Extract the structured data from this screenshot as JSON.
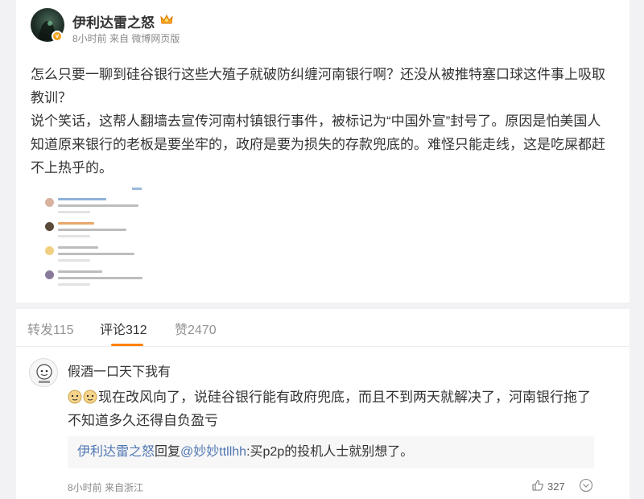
{
  "post": {
    "author": "伊利达雷之怒",
    "meta": "8小时前 来自 微博网页版",
    "paragraphs": [
      "怎么只要一聊到硅谷银行这些大殖子就破防纠缠河南银行啊？还没从被推特塞口球这件事上吸取教训？",
      "说个笑话，这帮人翻墙去宣传河南村镇银行事件，被标记为“中国外宣”封号了。原因是怕美国人知道原来银行的老板是要坐牢的，政府是要为损失的存款兜底的。难怪只能走线，这是吃屎都赶不上热乎的。"
    ]
  },
  "tabs": {
    "repost": "转发115",
    "comment": "评论312",
    "like": "赞2470"
  },
  "comment": {
    "author": "假酒一口天下我有",
    "text": "现在改风向了，说硅谷银行能有政府兜底，而且不到两天就解决了，河南银行拖了不知道多久还得自负盈亏",
    "reply": {
      "author": "伊利达雷之怒",
      "verb": "回复",
      "mention": "@妙妙ttllhh",
      "text": ":买p2p的投机人士就别想了。"
    },
    "meta": "8小时前 来自浙江",
    "likes": "327"
  },
  "colors": {
    "accent": "#ff8200",
    "link": "#4f77b3",
    "badge": "#f4a01b"
  }
}
